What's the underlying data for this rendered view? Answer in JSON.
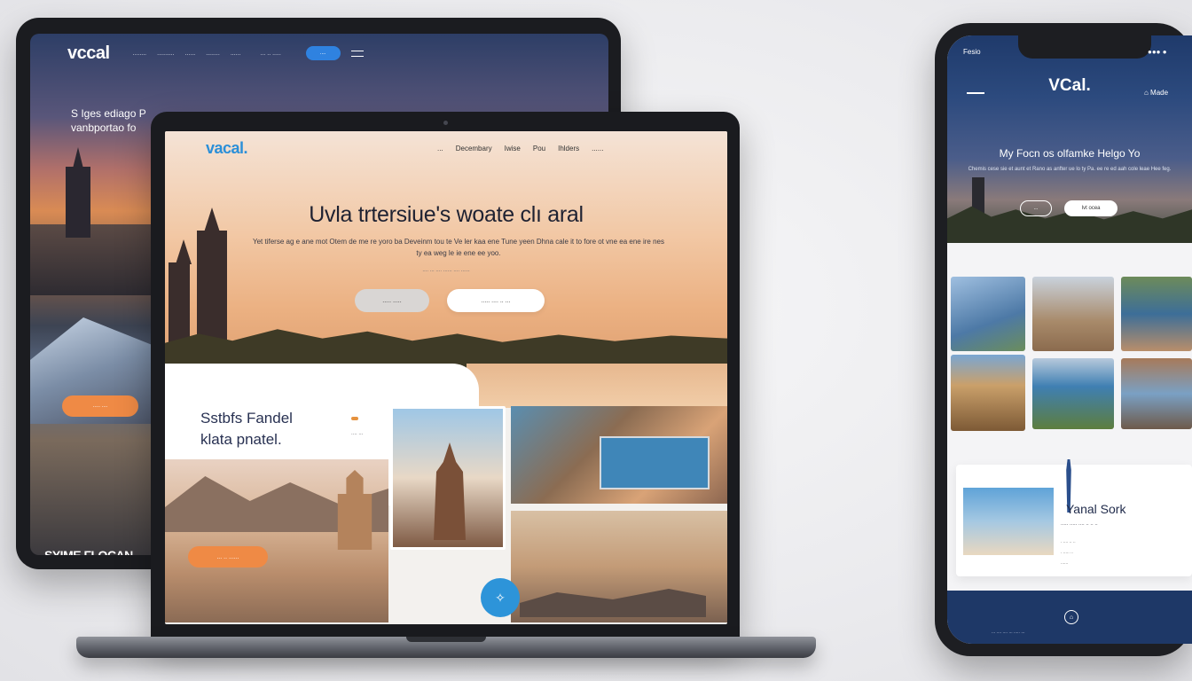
{
  "tablet": {
    "logo": "vccal",
    "nav_links": [
      "........",
      "..........",
      "......",
      "........",
      "......"
    ],
    "nav_more": "... .. .....",
    "pill_label": "....",
    "hero_text": "S Iges ediago P vanbportao fo",
    "cta_label": "..... ....",
    "bottom_text": "SYIME FLOCAN"
  },
  "laptop": {
    "logo": "vacal.",
    "nav_links": [
      "...",
      "Decembary",
      "Iwise",
      "Pou",
      "Ihlders",
      "......"
    ],
    "hero_title": "Uvla trtersiue's woate clı aral",
    "hero_sub": "Yet tiferse ag e ane mot Otem de me re yoro ba Deveinm tou te Ve ler kaa ene Tune yeen Dhna cale it to fore ot vne ea ene ire nes ty ea weg le ie ene ee yoo.",
    "hero_meta": ".... ... .... ...... .... ......",
    "hero_btn_primary": "..... .....",
    "hero_btn_secondary": "..... .... .. ...",
    "section_title": "Sstbfs Fandel klata pnatel.",
    "section_meta": ".... ...",
    "section_cta": "... .. ......",
    "chat_icon": "chat-icon"
  },
  "phone": {
    "status_left": "Fesio",
    "status_right": "●●● ●",
    "logo": "VCal.",
    "menu_right": "⌂ Made",
    "hero_title": "My Focn os olfamke Helgo Yo",
    "hero_sub": "Chemis cese sie et aunt et Rano as anfter ue lo ty Pa. ee re ed aah cole leae Hee feg.",
    "btn_ghost": "...",
    "btn_solid": "Ivt ocea",
    "card_title": "Yanal Sork",
    "card_sub": "..... ..... .... .. .. ..",
    "card_lines": [
      ". .... .. ..",
      ". ..... ..",
      "......"
    ],
    "footer_text": "... .... .... ... ..... ..."
  },
  "colors": {
    "accent_blue": "#2d94d9",
    "accent_orange": "#ef8a45",
    "navy": "#1e3867"
  }
}
